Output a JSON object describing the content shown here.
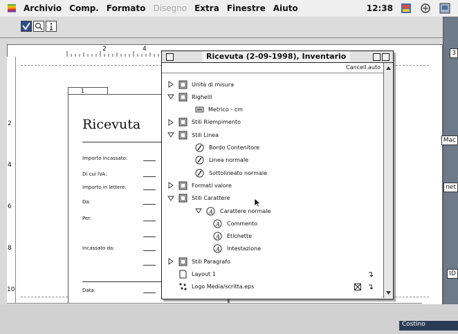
{
  "menubar": {
    "items": [
      "Archivio",
      "Comp.",
      "Formato",
      "Disegno",
      "Extra",
      "Finestre",
      "Aiuto"
    ],
    "disabled": [
      "Disegno"
    ],
    "clock": "12:38"
  },
  "document": {
    "page_tab": "1",
    "receipt_title": "Ricevuta",
    "fields": [
      "Importo incassato:",
      "Di cui IVA:",
      "Importo in lettere:",
      "Da:",
      "Per:",
      "Incassato da:",
      "Data:"
    ],
    "ruler_top": [
      "2",
      "4"
    ],
    "ruler_left": [
      "2",
      "4",
      "6",
      "8",
      "10"
    ],
    "side_labels": [
      "3",
      "Mac",
      "net",
      "ID"
    ],
    "taskbar_label": "Costino"
  },
  "palette": {
    "title": "Ricevuta (2-09-1998), Inventario",
    "header_button": "Cancell.auto",
    "rows": [
      {
        "label": "Unità di misura",
        "level": 0,
        "expanded": false
      },
      {
        "label": "Righelli",
        "level": 0,
        "expanded": true
      },
      {
        "label": "Metrico - cm",
        "level": 1,
        "expanded": null
      },
      {
        "label": "Stili Riempimento",
        "level": 0,
        "expanded": false
      },
      {
        "label": "Stili Linea",
        "level": 0,
        "expanded": true
      },
      {
        "label": "Bordo Contenitore",
        "level": 1,
        "expanded": null
      },
      {
        "label": "Linea normale",
        "level": 1,
        "expanded": null
      },
      {
        "label": "Sottolineato normale",
        "level": 1,
        "expanded": null
      },
      {
        "label": "Formati valore",
        "level": 0,
        "expanded": false
      },
      {
        "label": "Stili Carattere",
        "level": 0,
        "expanded": true
      },
      {
        "label": "Carattere normale",
        "level": 1,
        "expanded": true
      },
      {
        "label": "Commento",
        "level": 2,
        "expanded": null
      },
      {
        "label": "Etichette",
        "level": 2,
        "expanded": null
      },
      {
        "label": "Intestazione",
        "level": 2,
        "expanded": null
      },
      {
        "label": "Stili Paragrafo",
        "level": 0,
        "expanded": false
      },
      {
        "label": "Layout 1",
        "level": 0,
        "expanded": null
      },
      {
        "label": "Logo Media/scritta.eps",
        "level": 0,
        "expanded": null
      }
    ]
  }
}
